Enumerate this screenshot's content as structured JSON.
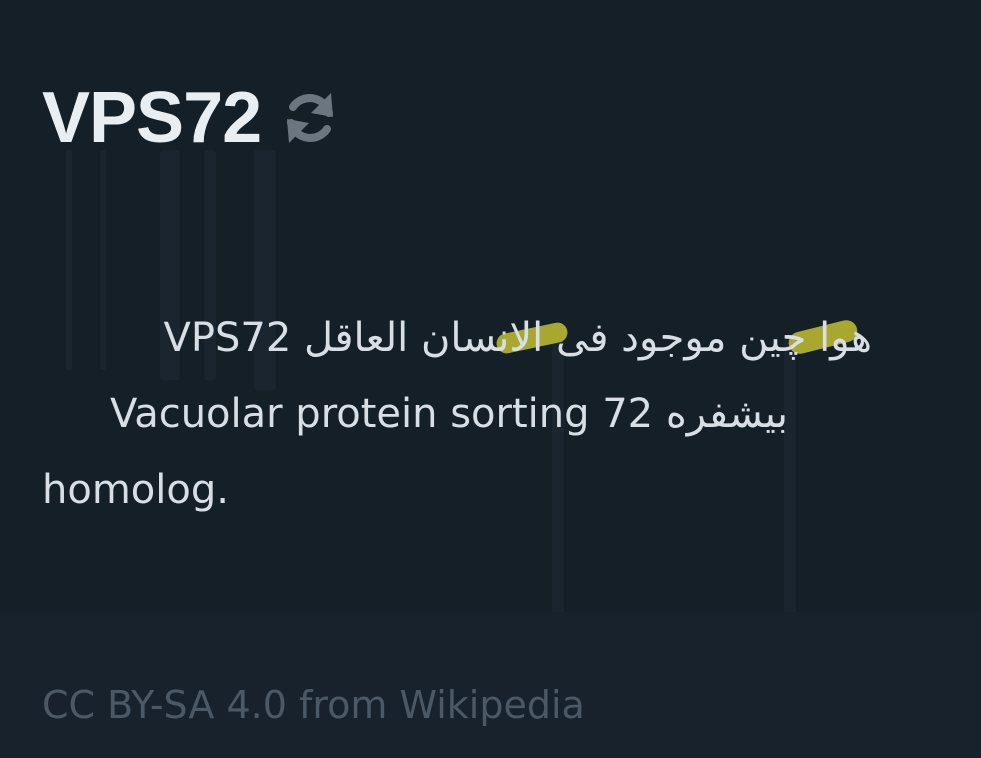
{
  "article": {
    "title": "VPS72",
    "refresh_icon": "refresh-icon",
    "summary_lines": [
      "هوا چين موجود فى الانسان العاقل VPS72",
      "بيشفره Vacuolar protein sorting 72",
      "homolog."
    ]
  },
  "footer": {
    "license_text": "CC BY-SA 4.0 from Wikipedia"
  },
  "colors": {
    "background": "#151f28",
    "footer_background": "#18222c",
    "title": "#e9eef2",
    "body_text": "#d8dee4",
    "icon": "#6b7680",
    "highlight": "#c2c133",
    "footer_text": "#4a5965"
  }
}
